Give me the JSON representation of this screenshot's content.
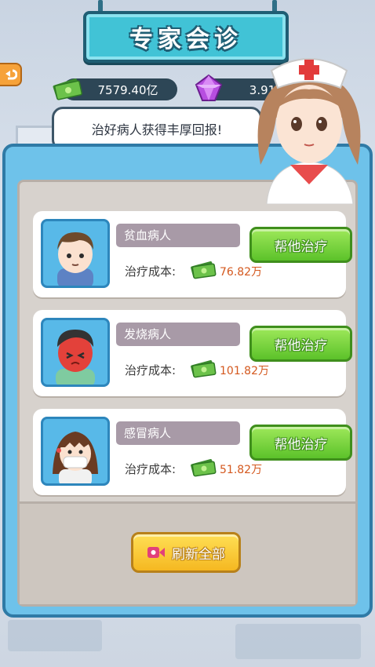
{
  "title": "专家会诊",
  "currency": {
    "money": "7579.40亿",
    "gems": "3.91万"
  },
  "bubble_text": "治好病人获得丰厚回报!",
  "cost_label": "治疗成本:",
  "patients": [
    {
      "name": "贫血病人",
      "cost": "76.82万",
      "button": "帮他治疗",
      "avatar_icon": "anemia-patient-avatar"
    },
    {
      "name": "发烧病人",
      "cost": "101.82万",
      "button": "帮他治疗",
      "avatar_icon": "fever-patient-avatar"
    },
    {
      "name": "感冒病人",
      "cost": "51.82万",
      "button": "帮他治疗",
      "avatar_icon": "cold-patient-avatar"
    }
  ],
  "refresh_label": "刷新全部",
  "colors": {
    "accent": "#41c3d6",
    "panel": "#6ec2ea",
    "treat_button": "#5cc22a",
    "refresh_button": "#f5b821",
    "cost_text": "#d4581e"
  }
}
